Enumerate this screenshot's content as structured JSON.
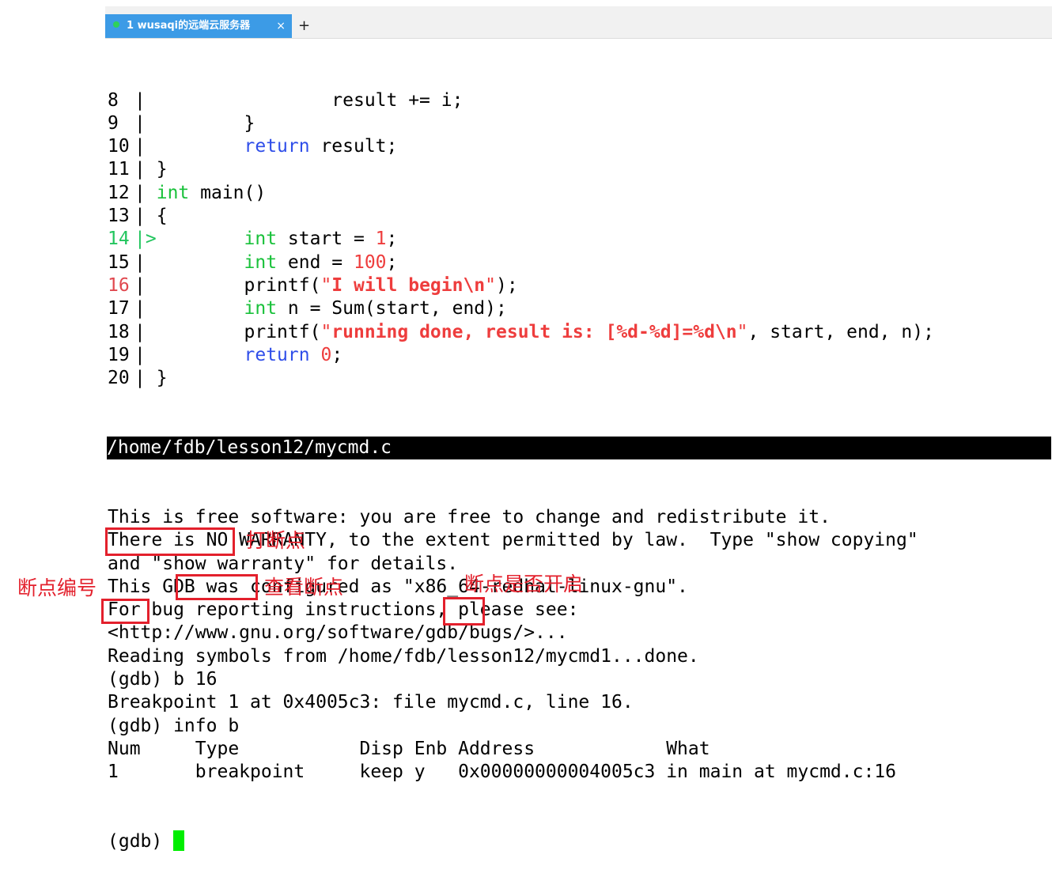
{
  "tab": {
    "label": "1 wusaqi的远端云服务器",
    "close": "×",
    "add": "+"
  },
  "source_lines": [
    {
      "no": "8",
      "code": "                result += i;"
    },
    {
      "no": "9",
      "code": "        }"
    },
    {
      "no": "10",
      "code": "        return result;"
    },
    {
      "no": "11",
      "code": "}"
    },
    {
      "no": "12",
      "code": "int main()"
    },
    {
      "no": "13",
      "code": "{"
    },
    {
      "no": "14",
      "code": "        int start = 1;",
      "current": true,
      "marker": "->"
    },
    {
      "no": "15",
      "code": "        int end = 100;"
    },
    {
      "no": "16",
      "code": "        printf(\"I will begin\\n\");",
      "breakpoint": true
    },
    {
      "no": "17",
      "code": "        int n = Sum(start, end);"
    },
    {
      "no": "18",
      "code": "        printf(\"running done, result is: [%d-%d]=%d\\n\", start, end, n);"
    },
    {
      "no": "19",
      "code": "        return 0;"
    },
    {
      "no": "20",
      "code": "}"
    }
  ],
  "status_file": "/home/fdb/lesson12/mycmd.c",
  "console_lines": [
    "This is free software: you are free to change and redistribute it.",
    "There is NO WARRANTY, to the extent permitted by law.  Type \"show copying\"",
    "and \"show warranty\" for details.",
    "This GDB was configured as \"x86_64-redhat-linux-gnu\".",
    "For bug reporting instructions, please see:",
    "<http://www.gnu.org/software/gdb/bugs/>...",
    "Reading symbols from /home/fdb/lesson12/mycmd1...done.",
    "(gdb) b 16",
    "Breakpoint 1 at 0x4005c3: file mycmd.c, line 16.",
    "(gdb) info b",
    "Num     Type           Disp Enb Address            What",
    "1       breakpoint     keep y   0x00000000004005c3 in main at mycmd.c:16"
  ],
  "prompt": "(gdb) ",
  "annotations": {
    "set_breakpoint": "打断点",
    "view_breakpoints": "查看断点",
    "breakpoint_number": "断点编号",
    "breakpoint_enabled": "断点是否开启"
  }
}
